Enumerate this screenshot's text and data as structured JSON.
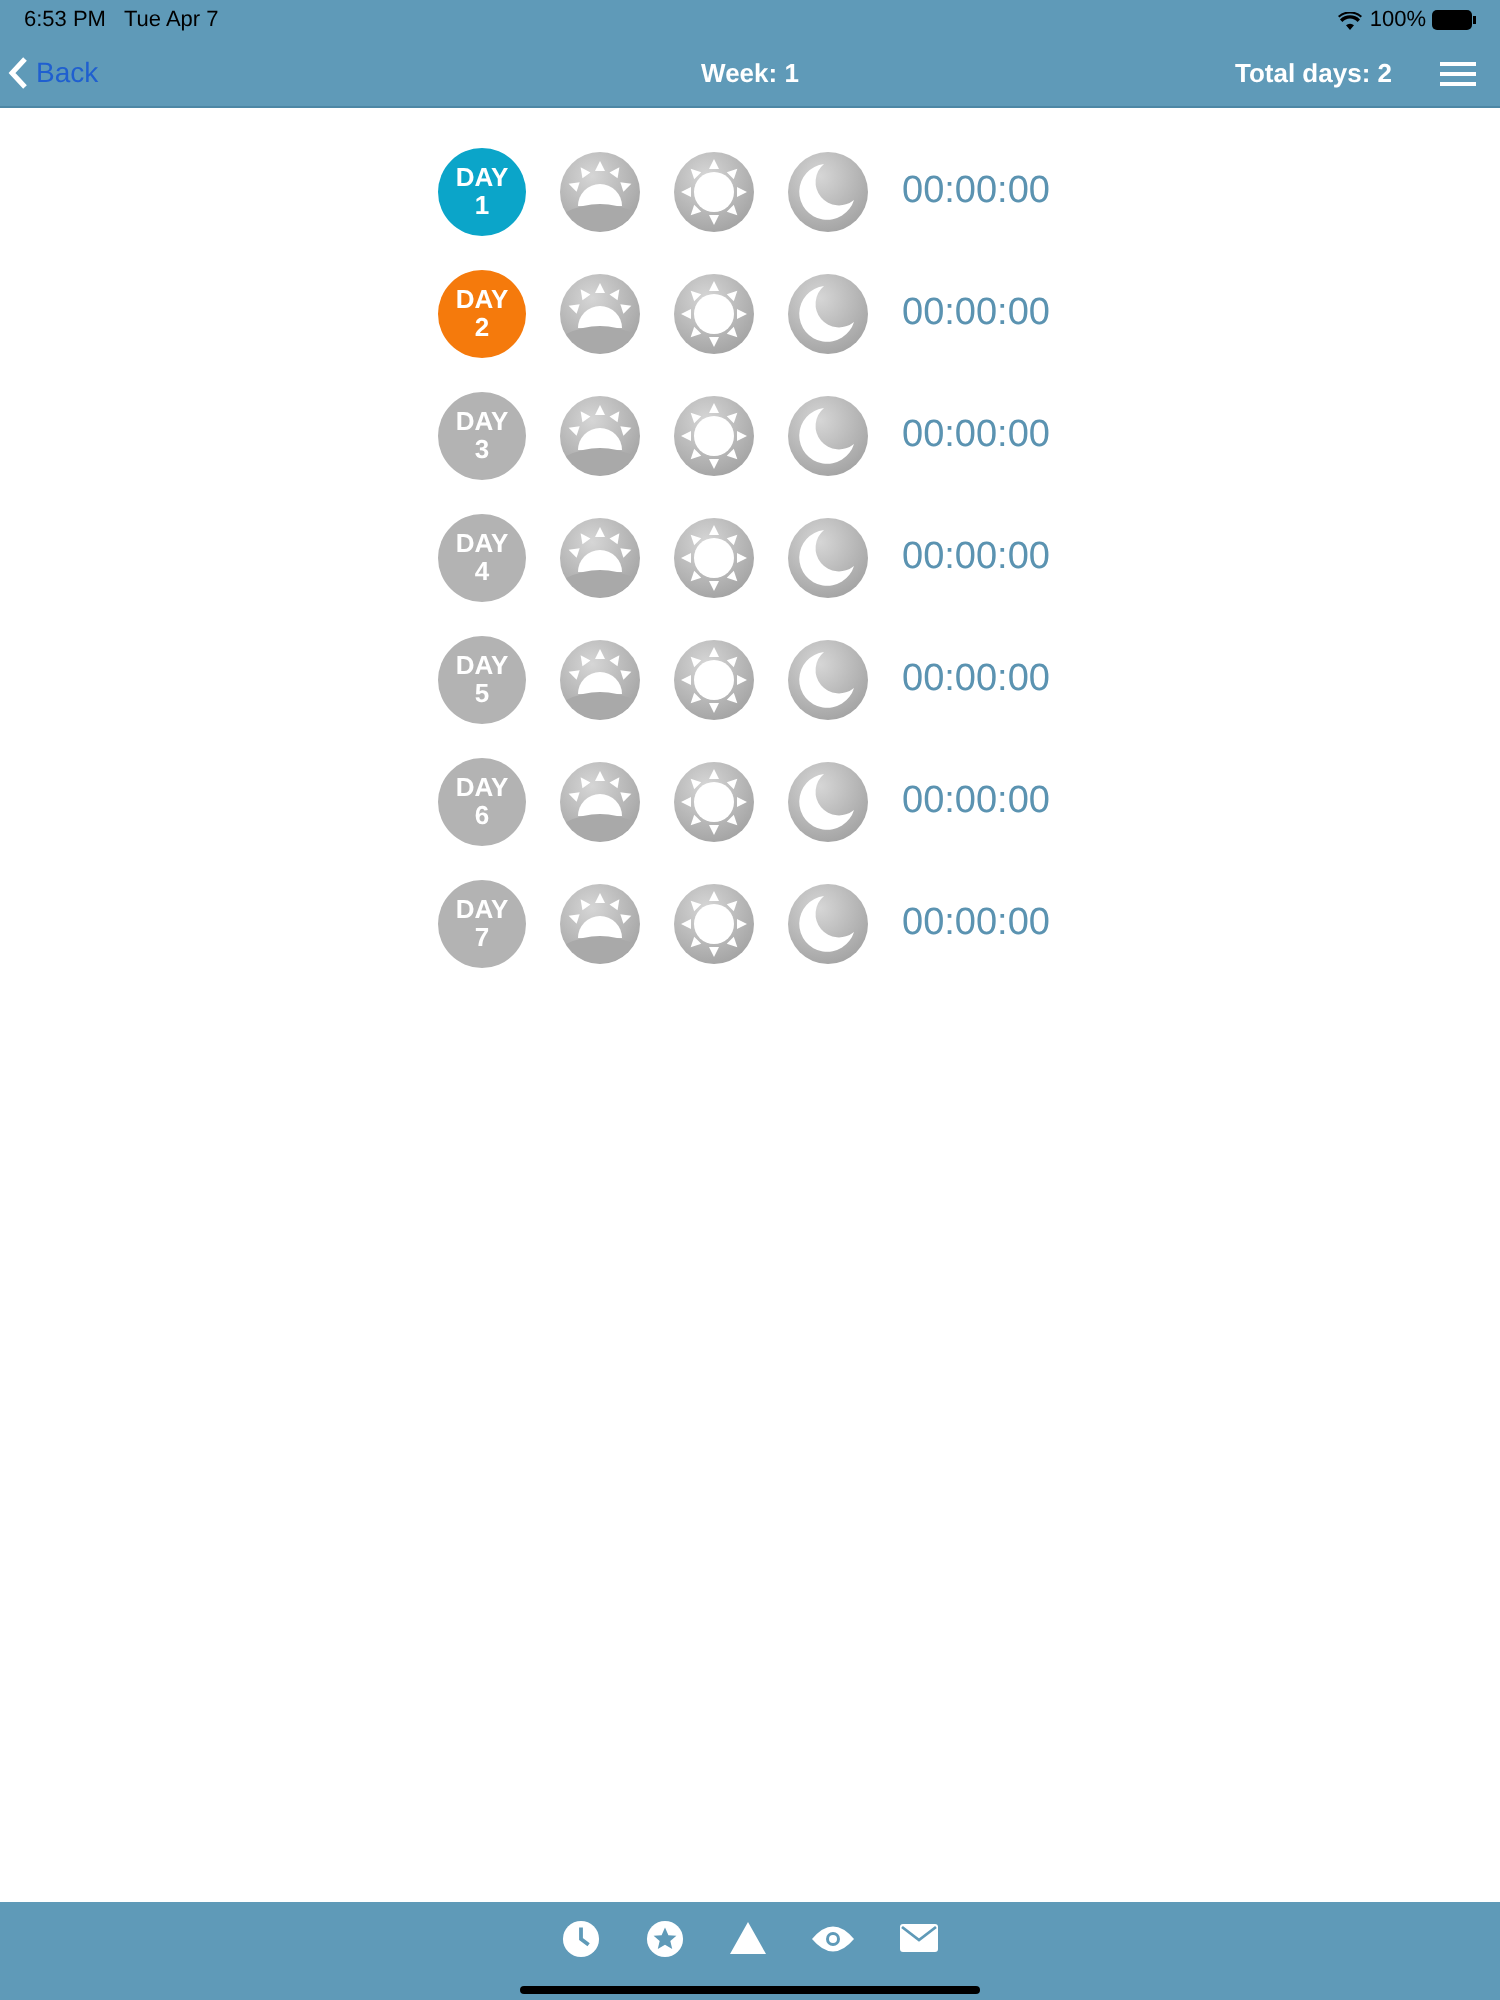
{
  "status_bar": {
    "time": "6:53 PM",
    "date": "Tue Apr 7",
    "battery": "100%"
  },
  "nav_bar": {
    "back": "Back",
    "title": "Week: 1",
    "total": "Total days: 2"
  },
  "days": [
    {
      "label": "DAY",
      "number": "1",
      "color": "#0ba5c9",
      "time": "00:00:00"
    },
    {
      "label": "DAY",
      "number": "2",
      "color": "#f57a0c",
      "time": "00:00:00"
    },
    {
      "label": "DAY",
      "number": "3",
      "color": "#b3b3b3",
      "time": "00:00:00"
    },
    {
      "label": "DAY",
      "number": "4",
      "color": "#b3b3b3",
      "time": "00:00:00"
    },
    {
      "label": "DAY",
      "number": "5",
      "color": "#b3b3b3",
      "time": "00:00:00"
    },
    {
      "label": "DAY",
      "number": "6",
      "color": "#b3b3b3",
      "time": "00:00:00"
    },
    {
      "label": "DAY",
      "number": "7",
      "color": "#b3b3b3",
      "time": "00:00:00"
    }
  ]
}
